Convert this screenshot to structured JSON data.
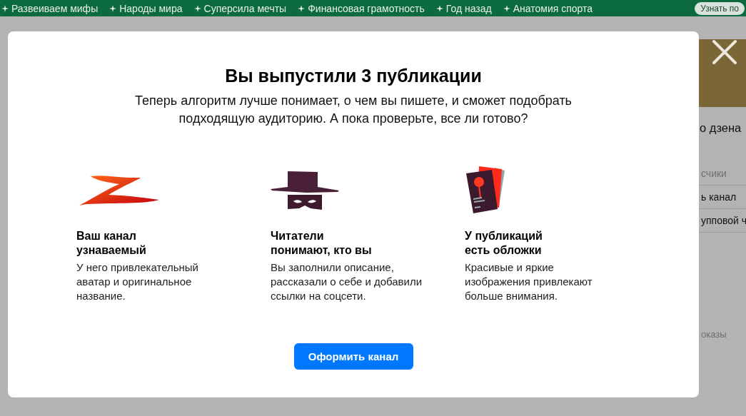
{
  "top_bar": {
    "topics": [
      "Развеиваем мифы",
      "Народы мира",
      "Суперсила мечты",
      "Финансовая грамотность",
      "Год назад",
      "Анатомия спорта"
    ],
    "action": "Узнать по"
  },
  "side_rail": {
    "heading": "о дзена",
    "items": [
      {
        "text": "счики",
        "kind": "caption"
      },
      {
        "text": "ь канал",
        "kind": "link"
      },
      {
        "text": "упповой ч",
        "kind": "link"
      },
      {
        "text": "оказы",
        "kind": "note"
      }
    ]
  },
  "dialog": {
    "title": "Вы выпустили 3 публикации",
    "subtitle": "Теперь алгоритм лучше понимает, о чем вы пишете, и сможет подобрать\nподходящую аудиторию. А пока проверьте, все ли готово?",
    "features": [
      {
        "kind": "logo",
        "title": "Ваш канал\nузнаваемый",
        "text": "У него привлекательный\nаватар и оригинальное\nназвание."
      },
      {
        "kind": "mask",
        "title": "Читатели\nпонимают, кто вы",
        "text": "Вы заполнили описание,\nрассказали о себе и добавили\nссылки на соцсети."
      },
      {
        "kind": "cards",
        "title": "У публикаций\nесть обложки",
        "text": "Красивые и яркие\nизображения привлекают\nбольше внимания."
      }
    ],
    "button": "Оформить канал"
  }
}
